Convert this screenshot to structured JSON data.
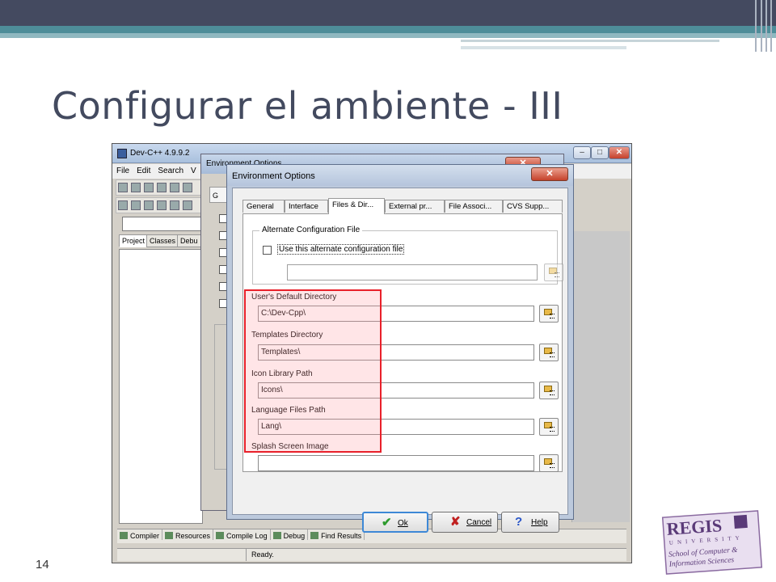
{
  "slide": {
    "title": "Configurar el ambiente - III",
    "page_number": "14"
  },
  "logo": {
    "name": "REGIS",
    "subtitle": "UNIVERSITY",
    "line1": "School of Computer &",
    "line2": "Information Sciences"
  },
  "devcpp": {
    "window_title": "Dev-C++ 4.9.9.2",
    "menu": [
      "File",
      "Edit",
      "Search",
      "V"
    ],
    "project_tabs": [
      "Project",
      "Classes",
      "Debu"
    ],
    "bottom_tabs": [
      "Compiler",
      "Resources",
      "Compile Log",
      "Debug",
      "Find Results"
    ],
    "status": "Ready."
  },
  "env_back": {
    "title": "Environment Options",
    "tab_stub": "G"
  },
  "env_dialog": {
    "title": "Environment Options",
    "tabs": [
      "General",
      "Interface",
      "Files & Dir...",
      "External pr...",
      "File Associ...",
      "CVS Supp..."
    ],
    "alt_group": {
      "legend": "Alternate Configuration File",
      "checkbox_label": "Use this alternate configuration file",
      "checked": false,
      "value": ""
    },
    "fields": [
      {
        "label": "User's Default Directory",
        "value": "C:\\Dev-Cpp\\"
      },
      {
        "label": "Templates Directory",
        "value": "Templates\\"
      },
      {
        "label": "Icon Library Path",
        "value": "Icons\\"
      },
      {
        "label": "Language Files Path",
        "value": "Lang\\"
      },
      {
        "label": "Splash Screen Image",
        "value": ""
      }
    ],
    "buttons": {
      "ok": "Ok",
      "cancel": "Cancel",
      "help": "Help"
    }
  },
  "colors": {
    "title_text": "#434a5f",
    "header_bar": "#444a60",
    "header_accent": "#4e8d99",
    "highlight_border": "#e8202a"
  }
}
